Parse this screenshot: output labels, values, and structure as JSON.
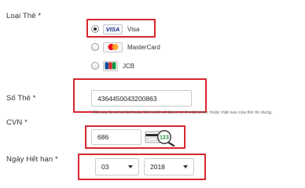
{
  "form": {
    "card_type_label": "Loại Thẻ *",
    "card_number_label": "Số Thẻ *",
    "cvn_label": "CVN *",
    "expiry_label": "Ngày Hết hạn *"
  },
  "card_types": [
    {
      "logo_text": "VISA",
      "label": "Visa",
      "selected": true,
      "icon": "visa-logo-icon"
    },
    {
      "logo_text": "",
      "label": "MasterCard",
      "selected": false,
      "icon": "mastercard-logo-icon"
    },
    {
      "logo_text": "",
      "label": "JCB",
      "selected": false,
      "icon": "jcb-logo-icon"
    }
  ],
  "card_number": {
    "value": "4364450043200863"
  },
  "cvn": {
    "value": "686",
    "help_text": "Mã này là số có ba hoặc bốn chữ số được in ở mặt trước hoặc mặt sau của thẻ tín dụng.",
    "image_number": "123"
  },
  "expiry": {
    "month": "03",
    "year": "2018"
  },
  "colors": {
    "highlight": "#d8262e",
    "visa_blue": "#1a2e8a",
    "mastercard_red": "#eb001b",
    "mastercard_orange": "#f79e1b",
    "text": "#333333",
    "help_text": "#666666"
  }
}
